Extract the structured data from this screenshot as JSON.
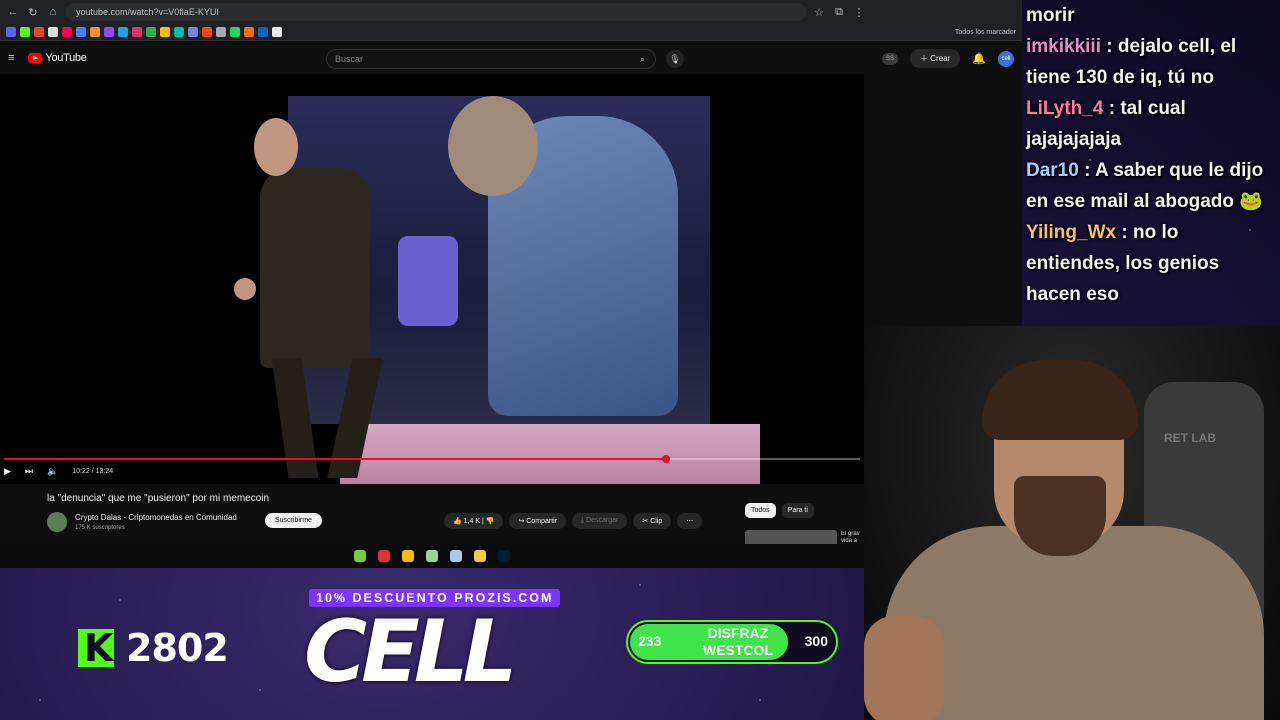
{
  "browser": {
    "url": "youtube.com/watch?v=V0flaE-KYUI",
    "all_bookmarks": "Todos los marcador"
  },
  "youtube": {
    "logo": "YouTube",
    "search_placeholder": "Buscar",
    "create_label": "Crear",
    "ss_badge": "SS",
    "avatar_text": "cell"
  },
  "player": {
    "time": "10:22 / 13:24",
    "progress_fraction": 0.773
  },
  "video": {
    "title": "la \"denuncia\" que me \"pusieron\" por mi memecoin",
    "channel": "Crypto Dalas - Criptomonedas en Comunidad",
    "subscribers": "175 K suscriptores",
    "subscribe_label": "Suscribirme",
    "likes": "1,4 K",
    "share_label": "Compartir",
    "download_label": "Descargar",
    "clip_label": "Clip",
    "more_icon": "⋯"
  },
  "sidebar_chips": [
    "Todos",
    "Para ti"
  ],
  "recommend_snippet": "El grav vida a",
  "chat": [
    {
      "user": "",
      "text": "morir",
      "color": "#f2f2f2"
    },
    {
      "user": "imkikkiii",
      "text": "dejalo cell, el tiene 130 de iq, tú no",
      "color": "#e88ad0"
    },
    {
      "user": "LiLyth_4",
      "text": "tal cual jajajajajaja",
      "color": "#ff7aa8"
    },
    {
      "user": "Dar10",
      "text": "A saber que le dijo en ese mail al abogado",
      "color": "#9fd0ff"
    },
    {
      "user": "Yiling_Wx",
      "text": "no lo entiendes, los genios hacen eso",
      "color": "#f7c35a"
    }
  ],
  "overlay": {
    "kick_count": "2802",
    "promo": "10% DESCUENTO PROZIS.COM",
    "streamer_name": "CELL",
    "goal_current": "233",
    "goal_label": "DISFRAZ WESTCOL",
    "goal_target": "300",
    "goal_fraction": 0.777,
    "chair_brand": "RET LAB"
  }
}
